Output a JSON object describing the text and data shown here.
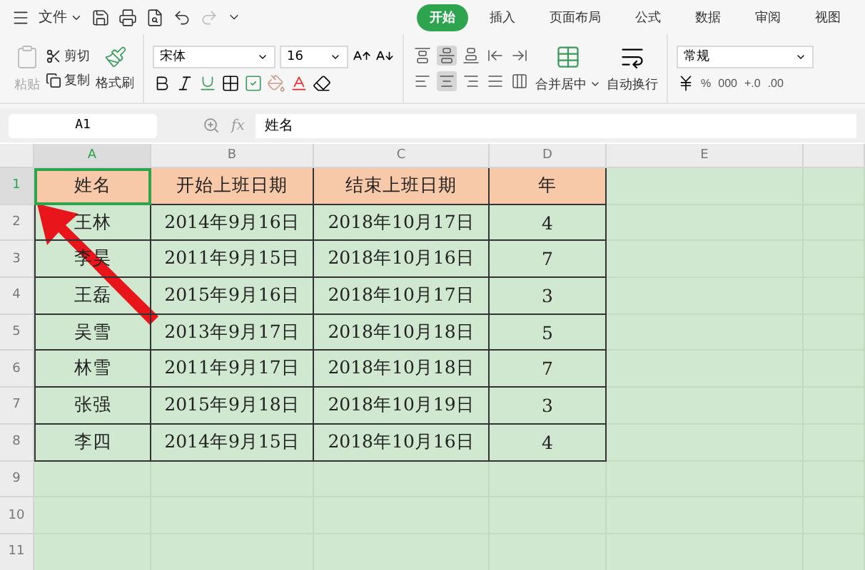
{
  "title_bar": {
    "menu": "文件",
    "tabs": [
      {
        "label": "开始",
        "selected": true
      },
      {
        "label": "插入",
        "selected": false
      },
      {
        "label": "页面布局",
        "selected": false
      },
      {
        "label": "公式",
        "selected": false
      },
      {
        "label": "数据",
        "selected": false
      },
      {
        "label": "审阅",
        "selected": false
      },
      {
        "label": "视图",
        "selected": false
      }
    ]
  },
  "ribbon": {
    "paste": "粘贴",
    "cut": "剪切",
    "copy": "复制",
    "format_painter": "格式刷",
    "font_name": "宋体",
    "font_size": "16",
    "align_buttons": [
      {
        "kind": "top",
        "selected": false
      },
      {
        "kind": "middle",
        "selected": true
      },
      {
        "kind": "bottom",
        "selected": false
      },
      {
        "kind": "outdent",
        "selected": false
      },
      {
        "kind": "indent",
        "selected": false
      },
      {
        "kind": "left",
        "selected": false
      },
      {
        "kind": "center",
        "selected": true
      },
      {
        "kind": "right",
        "selected": false
      },
      {
        "kind": "justify",
        "selected": false
      },
      {
        "kind": "distribute",
        "selected": false
      }
    ],
    "merge": "合并居中",
    "wrap": "自动换行",
    "number_format": "常规",
    "number_buttons": [
      "%",
      "000",
      "+.0",
      ".00"
    ]
  },
  "formula_bar": {
    "cell_ref": "A1",
    "fx": "fx",
    "value": "姓名"
  },
  "sheet": {
    "columns": [
      {
        "label": "A",
        "selected": true
      },
      {
        "label": "B",
        "selected": false
      },
      {
        "label": "C",
        "selected": false
      },
      {
        "label": "D",
        "selected": false
      },
      {
        "label": "E",
        "selected": false
      }
    ],
    "rows": [
      {
        "label": "1",
        "selected": true
      },
      {
        "label": "2",
        "selected": false
      },
      {
        "label": "3",
        "selected": false
      },
      {
        "label": "4",
        "selected": false
      },
      {
        "label": "5",
        "selected": false
      },
      {
        "label": "6",
        "selected": false
      },
      {
        "label": "7",
        "selected": false
      },
      {
        "label": "8",
        "selected": false
      },
      {
        "label": "9",
        "selected": false
      },
      {
        "label": "10",
        "selected": false
      },
      {
        "label": "11",
        "selected": false
      }
    ],
    "header": [
      {
        "text": "姓名",
        "selected": true
      },
      {
        "text": "开始上班日期",
        "selected": false
      },
      {
        "text": "结束上班日期",
        "selected": false
      },
      {
        "text": "年",
        "selected": false
      }
    ],
    "data": [
      [
        "王林",
        "2014年9月16日",
        "2018年10月17日",
        "4"
      ],
      [
        "李昊",
        "2011年9月15日",
        "2018年10月16日",
        "7"
      ],
      [
        "王磊",
        "2015年9月16日",
        "2018年10月17日",
        "3"
      ],
      [
        "吴雪",
        "2013年9月17日",
        "2018年10月18日",
        "5"
      ],
      [
        "林雪",
        "2011年9月17日",
        "2018年10月18日",
        "7"
      ],
      [
        "张强",
        "2015年9月18日",
        "2018年10月19日",
        "3"
      ],
      [
        "李四",
        "2014年9月15日",
        "2018年10月16日",
        "4"
      ]
    ]
  }
}
